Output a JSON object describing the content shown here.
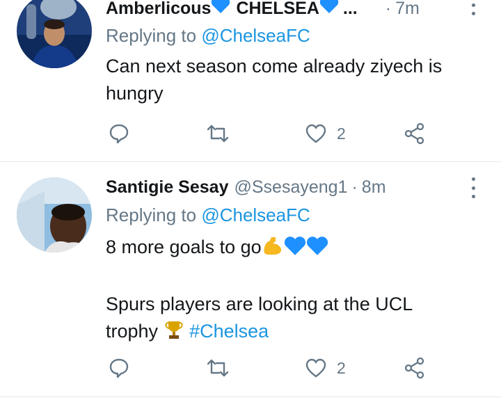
{
  "tweets": [
    {
      "display_name": "Amberlicous",
      "display_name_suffix": "CHELSEA",
      "truncation": "...",
      "time": "7m",
      "replying_to_prefix": "Replying to",
      "replying_to_handle": "@ChelseaFC",
      "text": "Can next season come already ziyech is hungry",
      "likes": "2"
    },
    {
      "display_name": "Santigie Sesay",
      "handle": "@Ssesayeng1",
      "separator": "·",
      "time": "8m",
      "replying_to_prefix": "Replying to",
      "replying_to_handle": "@ChelseaFC",
      "text_line1": "8 more goals to go",
      "text_line2": "Spurs players are looking at the UCL",
      "text_line3": "trophy",
      "hashtag": "#Chelsea",
      "likes": "2"
    }
  ],
  "icons": {
    "reply": "reply-bubble-icon",
    "retweet": "retweet-icon",
    "like": "heart-outline-icon",
    "share": "share-icon",
    "more": "more-vertical-icon"
  },
  "colors": {
    "link": "#1b95e0",
    "muted": "#657786",
    "heart_emoji": "#1e90ff",
    "muscle_emoji": "#f5b820",
    "trophy_emoji": "#d9a300"
  }
}
